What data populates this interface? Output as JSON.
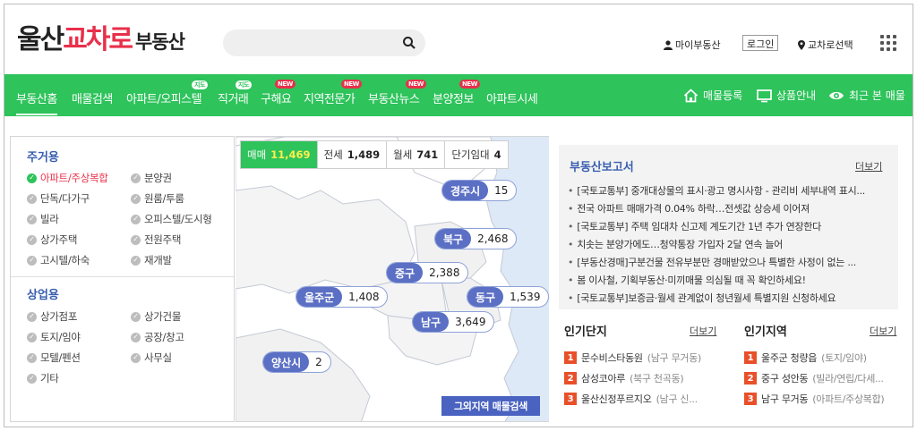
{
  "header": {
    "logo": {
      "part1": "울산",
      "part2": "교차로",
      "part3": "부동산"
    },
    "search": {
      "placeholder": ""
    },
    "my_realestate": "마이부동산",
    "login": "로그인",
    "region_select": "교차로선택"
  },
  "nav": {
    "items": [
      {
        "label": "부동산홈",
        "badge": ""
      },
      {
        "label": "매물검색",
        "badge": ""
      },
      {
        "label": "아파트/오피스텔",
        "badge": "지도"
      },
      {
        "label": "직거래",
        "badge": "지도"
      },
      {
        "label": "구해요",
        "badge": "NEW"
      },
      {
        "label": "지역전문가",
        "badge": "NEW"
      },
      {
        "label": "부동산뉴스",
        "badge": "NEW"
      },
      {
        "label": "분양정보",
        "badge": "NEW"
      },
      {
        "label": "아파트시세",
        "badge": ""
      }
    ],
    "right": [
      {
        "label": "매물등록",
        "icon": "home-icon"
      },
      {
        "label": "상품안내",
        "icon": "monitor-icon"
      },
      {
        "label": "최근 본 매물",
        "icon": "eye-icon"
      }
    ],
    "colors": {
      "nav_bg": "#2ec35b",
      "brand_red": "#e8304a",
      "section_blue": "#3a5fb0"
    }
  },
  "filters": {
    "residential": {
      "title": "주거용",
      "options": [
        "아파트/주상복합",
        "분양권",
        "단독/다가구",
        "원룸/투룸",
        "빌라",
        "오피스텔/도시형",
        "상가주택",
        "전원주택",
        "고시텔/하숙",
        "재개발"
      ],
      "selected": "아파트/주상복합"
    },
    "commercial": {
      "title": "상업용",
      "options": [
        "상가점포",
        "상가건물",
        "토지/임야",
        "공장/창고",
        "모텔/펜션",
        "사무실",
        "기타"
      ]
    }
  },
  "map": {
    "tabs": [
      {
        "label": "매매",
        "count": "11,469",
        "active": true
      },
      {
        "label": "전세",
        "count": "1,489",
        "active": false
      },
      {
        "label": "월세",
        "count": "741",
        "active": false
      },
      {
        "label": "단기임대",
        "count": "4",
        "active": false
      }
    ],
    "districts": [
      {
        "name": "경주시",
        "count": "15"
      },
      {
        "name": "북구",
        "count": "2,468"
      },
      {
        "name": "중구",
        "count": "2,388"
      },
      {
        "name": "울주군",
        "count": "1,408"
      },
      {
        "name": "동구",
        "count": "1,539"
      },
      {
        "name": "남구",
        "count": "3,649"
      },
      {
        "name": "양산시",
        "count": "2"
      }
    ],
    "other_region_button": "그외지역 매물검색"
  },
  "report": {
    "title": "부동산보고서",
    "more": "더보기",
    "news": [
      "[국토교통부] 중개대상물의 표시·광고 명시사항 - 관리비 세부내역 표시...",
      "전국 아파트 매매가격 0.04% 하락…전셋값 상승세 이어져",
      "[국토교통부] 주택 임대차 신고제 계도기간 1년 추가 연장한다",
      "치솟는 분양가에도…청약통장 가입자 2달 연속 늘어",
      "[부동산경매]구분건물 전유부분만 경매받았으나 특별한 사정이 없는 ...",
      "봄 이사철, 기획부동산·미끼매물 의심될 때 꼭 확인하세요!",
      "[국토교통부]보증금·월세 관계없이 청년월세 특별지원 신청하세요"
    ]
  },
  "popular_complex": {
    "title": "인기단지",
    "more": "더보기",
    "items": [
      {
        "rank": "1",
        "name": "문수비스타동원",
        "sub": "(남구 무거동)"
      },
      {
        "rank": "2",
        "name": "삼성코아루",
        "sub": "(북구 천곡동)"
      },
      {
        "rank": "3",
        "name": "울산신정푸르지오",
        "sub": "(남구 신..."
      }
    ]
  },
  "popular_region": {
    "title": "인기지역",
    "more": "더보기",
    "items": [
      {
        "rank": "1",
        "name": "울주군 청량읍",
        "sub": "(토지/임야)"
      },
      {
        "rank": "2",
        "name": "중구 성안동",
        "sub": "(빌라/연립/다세..."
      },
      {
        "rank": "3",
        "name": "남구 무거동",
        "sub": "(아파트/주상복합)"
      }
    ]
  }
}
